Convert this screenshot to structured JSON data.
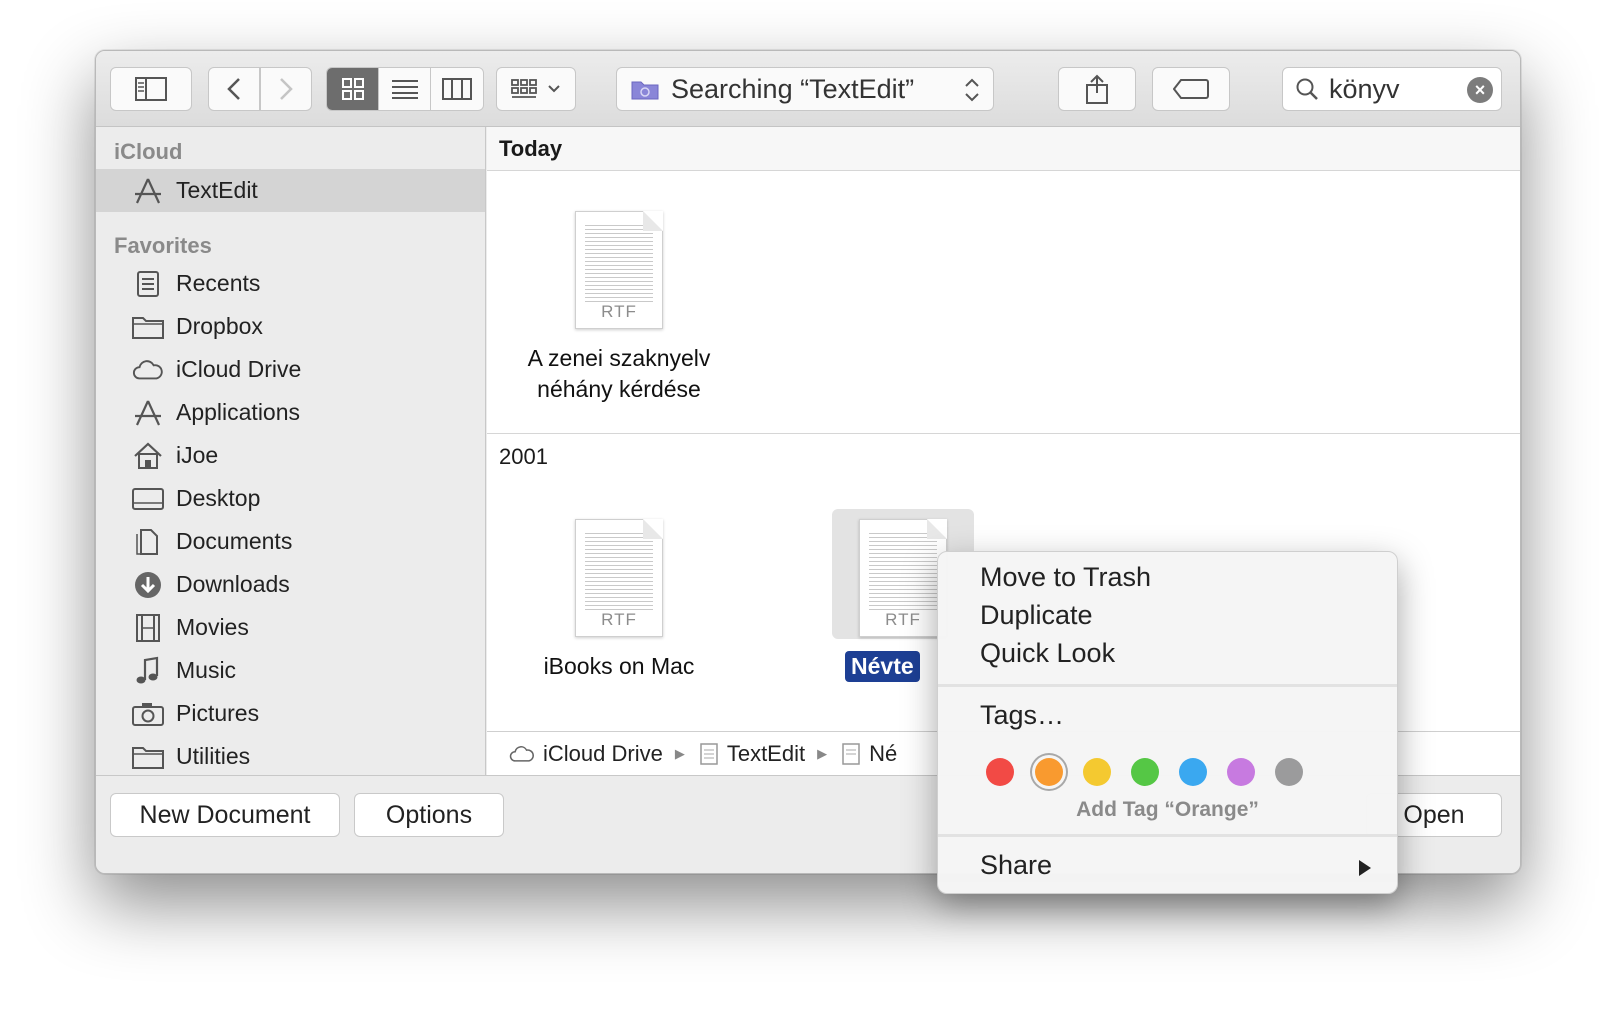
{
  "toolbar": {
    "path_label": "Searching “TextEdit”",
    "search_value": "könyv"
  },
  "sidebar": {
    "icloud_heading": "iCloud",
    "icloud_items": [
      {
        "label": "TextEdit",
        "icon": "app-store-icon"
      }
    ],
    "favorites_heading": "Favorites",
    "favorites": [
      {
        "label": "Recents",
        "icon": "recents-icon"
      },
      {
        "label": "Dropbox",
        "icon": "folder-icon"
      },
      {
        "label": "iCloud Drive",
        "icon": "cloud-icon"
      },
      {
        "label": "Applications",
        "icon": "applications-icon"
      },
      {
        "label": "iJoe",
        "icon": "home-icon"
      },
      {
        "label": "Desktop",
        "icon": "desktop-icon"
      },
      {
        "label": "Documents",
        "icon": "documents-icon"
      },
      {
        "label": "Downloads",
        "icon": "downloads-icon"
      },
      {
        "label": "Movies",
        "icon": "movies-icon"
      },
      {
        "label": "Music",
        "icon": "music-icon"
      },
      {
        "label": "Pictures",
        "icon": "camera-icon"
      },
      {
        "label": "Utilities",
        "icon": "folder-icon"
      }
    ]
  },
  "content": {
    "today_heading": "Today",
    "year_heading": "2001",
    "files": [
      {
        "name_line1": "A zenei szaknyelv",
        "name_line2": "néhány kérdése",
        "type": "RTF"
      },
      {
        "name_line1": "iBooks on Mac",
        "type": "RTF"
      },
      {
        "name_line1": "Névte",
        "type": "RTF"
      }
    ]
  },
  "pathbar": {
    "items": [
      "iCloud Drive",
      "TextEdit",
      "Né"
    ]
  },
  "bottom": {
    "new_document": "New Document",
    "options": "Options",
    "open": "Open"
  },
  "menu": {
    "items": [
      "Move to Trash",
      "Duplicate",
      "Quick Look"
    ],
    "tags": "Tags…",
    "tag_colors": [
      "#f24a45",
      "#f99a2f",
      "#f4c930",
      "#55c745",
      "#3aa8f0",
      "#c77ae0",
      "#9b9b9c"
    ],
    "add_tag": "Add Tag “Orange”",
    "share": "Share"
  }
}
